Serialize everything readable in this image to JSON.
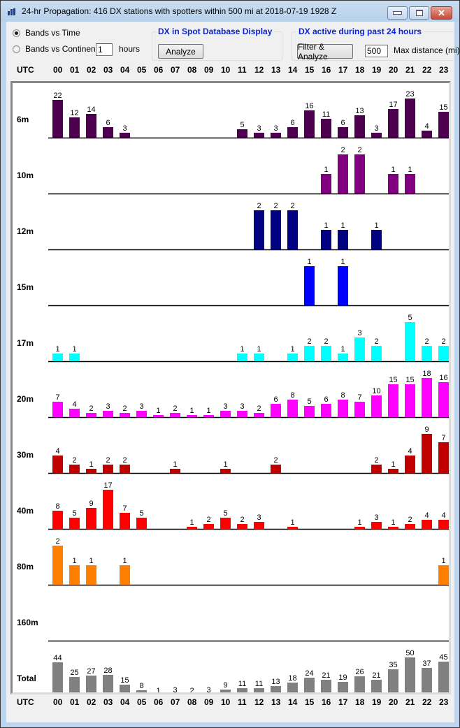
{
  "window": {
    "title": "24-hr Propagation: 416 DX stations with spotters within 500 mi at 2018-07-19 1928 Z",
    "app_icon": "bar-chart-icon",
    "controls": {
      "minimize": "minimize-icon",
      "maximize": "maximize-icon",
      "close": "close-icon"
    }
  },
  "options": {
    "bands_vs_time_label": "Bands vs Time",
    "bands_vs_time_selected": true,
    "bands_vs_continents_label": "Bands vs Continents",
    "bands_vs_continents_selected": false,
    "hours_value": "1",
    "hours_label": "hours"
  },
  "spot_db_group": {
    "title": "DX in Spot Database Display",
    "analyze_label": "Analyze"
  },
  "dx_active_group": {
    "title": "DX active during past 24 hours",
    "filter_label": "Filter & Analyze",
    "distance_value": "500",
    "distance_label": "Max distance (mi)"
  },
  "utc_label": "UTC",
  "hours": [
    "00",
    "01",
    "02",
    "03",
    "04",
    "05",
    "06",
    "07",
    "08",
    "09",
    "10",
    "11",
    "12",
    "13",
    "14",
    "15",
    "16",
    "17",
    "18",
    "19",
    "20",
    "21",
    "22",
    "23"
  ],
  "chart_data": {
    "type": "bar",
    "title": "24-hr Propagation: 416 DX stations with spotters within 500 mi at 2018-07-19 1928 Z",
    "xlabel": "UTC",
    "categories": [
      "00",
      "01",
      "02",
      "03",
      "04",
      "05",
      "06",
      "07",
      "08",
      "09",
      "10",
      "11",
      "12",
      "13",
      "14",
      "15",
      "16",
      "17",
      "18",
      "19",
      "20",
      "21",
      "22",
      "23"
    ],
    "layout": "small-multiples (one row per band), each row scaled to its own max",
    "series": [
      {
        "name": "6m",
        "color": "#4d004d",
        "values": [
          22,
          12,
          14,
          6,
          3,
          null,
          null,
          null,
          null,
          null,
          null,
          5,
          3,
          3,
          6,
          16,
          11,
          6,
          13,
          3,
          17,
          23,
          4,
          15
        ]
      },
      {
        "name": "10m",
        "color": "#800080",
        "values": [
          null,
          null,
          null,
          null,
          null,
          null,
          null,
          null,
          null,
          null,
          null,
          null,
          null,
          null,
          null,
          null,
          1,
          2,
          2,
          null,
          1,
          1,
          null,
          null
        ]
      },
      {
        "name": "12m",
        "color": "#000080",
        "values": [
          null,
          null,
          null,
          null,
          null,
          null,
          null,
          null,
          null,
          null,
          null,
          null,
          2,
          2,
          2,
          null,
          1,
          1,
          null,
          1,
          null,
          null,
          null,
          null
        ]
      },
      {
        "name": "15m",
        "color": "#0000ff",
        "values": [
          null,
          null,
          null,
          null,
          null,
          null,
          null,
          null,
          null,
          null,
          null,
          null,
          null,
          null,
          null,
          1,
          null,
          1,
          null,
          null,
          null,
          null,
          null,
          null
        ]
      },
      {
        "name": "17m",
        "color": "#00ffff",
        "values": [
          1,
          1,
          null,
          null,
          null,
          null,
          null,
          null,
          null,
          null,
          null,
          1,
          1,
          null,
          1,
          2,
          2,
          1,
          3,
          2,
          null,
          5,
          2,
          2
        ]
      },
      {
        "name": "20m",
        "color": "#ff00ff",
        "values": [
          7,
          4,
          2,
          3,
          2,
          3,
          1,
          2,
          1,
          1,
          3,
          3,
          2,
          6,
          8,
          5,
          6,
          8,
          7,
          10,
          15,
          15,
          18,
          16
        ]
      },
      {
        "name": "30m",
        "color": "#c00000",
        "values": [
          4,
          2,
          1,
          2,
          2,
          null,
          null,
          1,
          null,
          null,
          1,
          null,
          null,
          2,
          null,
          null,
          null,
          null,
          null,
          2,
          1,
          4,
          9,
          7
        ]
      },
      {
        "name": "40m",
        "color": "#ff0000",
        "values": [
          8,
          5,
          9,
          17,
          7,
          5,
          null,
          null,
          1,
          2,
          5,
          2,
          3,
          null,
          1,
          null,
          null,
          null,
          1,
          3,
          1,
          2,
          4,
          4
        ]
      },
      {
        "name": "80m",
        "color": "#ff8000",
        "values": [
          2,
          1,
          1,
          null,
          1,
          null,
          null,
          null,
          null,
          null,
          null,
          null,
          null,
          null,
          null,
          null,
          null,
          null,
          null,
          null,
          null,
          null,
          null,
          1
        ]
      },
      {
        "name": "160m",
        "color": "#808000",
        "values": [
          null,
          null,
          null,
          null,
          null,
          null,
          null,
          null,
          null,
          null,
          null,
          null,
          null,
          null,
          null,
          null,
          null,
          null,
          null,
          null,
          null,
          null,
          null,
          null
        ]
      },
      {
        "name": "Total",
        "color": "#808080",
        "values": [
          44,
          25,
          27,
          28,
          15,
          8,
          1,
          3,
          2,
          3,
          9,
          11,
          11,
          13,
          18,
          24,
          21,
          19,
          26,
          21,
          35,
          50,
          37,
          45
        ]
      }
    ],
    "grid": false,
    "legend": "none (band labels at left of each row)"
  }
}
